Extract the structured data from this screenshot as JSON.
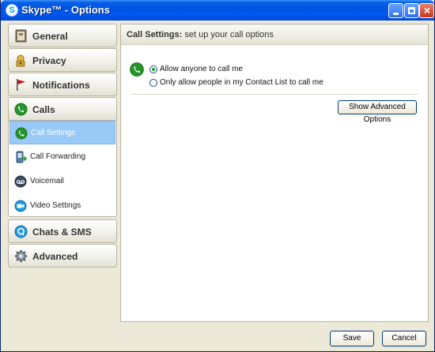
{
  "window": {
    "title": "Skype™ - Options",
    "app_icon": "skype-logo",
    "title_icon_letter": "S",
    "close_glyph": "×"
  },
  "sidebar": {
    "categories": [
      {
        "label": "General",
        "icon": "general-icon"
      },
      {
        "label": "Privacy",
        "icon": "privacy-icon"
      },
      {
        "label": "Notifications",
        "icon": "flag-icon"
      },
      {
        "label": "Calls",
        "icon": "phone-icon"
      },
      {
        "label": "Chats & SMS",
        "icon": "chat-icon"
      },
      {
        "label": "Advanced",
        "icon": "gear-icon"
      }
    ],
    "calls_items": [
      {
        "label": "Call Settings",
        "icon": "call-settings-icon",
        "active": true
      },
      {
        "label": "Call Forwarding",
        "icon": "call-forwarding-icon"
      },
      {
        "label": "Voicemail",
        "icon": "voicemail-icon"
      },
      {
        "label": "Video Settings",
        "icon": "video-icon"
      }
    ]
  },
  "main": {
    "header_bold": "Call Settings:",
    "header_rest": "set up your call options",
    "options": [
      {
        "label": "Allow anyone to call me",
        "selected": true
      },
      {
        "label": "Only allow people in my Contact List to call me",
        "selected": false
      }
    ],
    "advanced_button": "Show Advanced Options"
  },
  "footer": {
    "save": "Save",
    "cancel": "Cancel"
  },
  "colors": {
    "titlebar": "#0054e3",
    "active_item": "#99c9f7",
    "call_green": "#1d8a23"
  }
}
